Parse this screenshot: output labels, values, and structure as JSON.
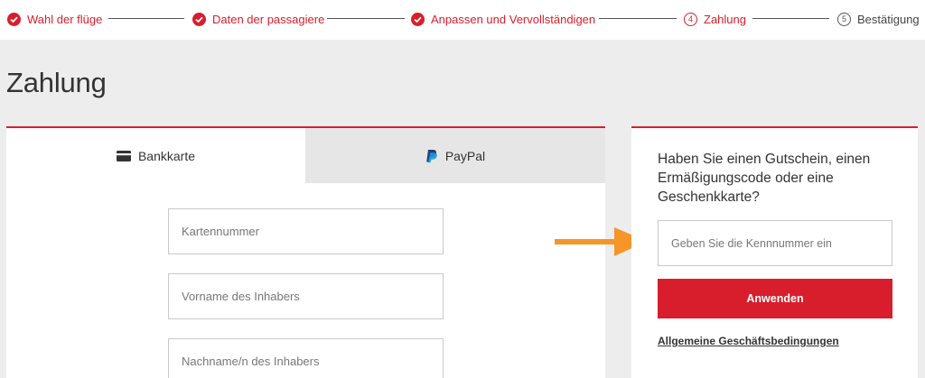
{
  "stepper": {
    "steps": [
      {
        "label": "Wahl der flüge",
        "state": "done"
      },
      {
        "label": "Daten der passagiere",
        "state": "done"
      },
      {
        "label": "Anpassen und Vervollständigen",
        "state": "done"
      },
      {
        "label": "Zahlung",
        "state": "current",
        "number": "4"
      },
      {
        "label": "Bestätigung",
        "state": "pending",
        "number": "5"
      }
    ]
  },
  "page": {
    "title": "Zahlung"
  },
  "payment": {
    "tabs": [
      {
        "label": "Bankkarte",
        "icon": "card-icon",
        "active": true
      },
      {
        "label": "PayPal",
        "icon": "paypal-icon",
        "active": false
      }
    ],
    "fields": {
      "card_number_placeholder": "Kartennummer",
      "first_name_placeholder": "Vorname des Inhabers",
      "last_name_placeholder": "Nachname/n des Inhabers"
    }
  },
  "voucher": {
    "question": "Haben Sie einen Gutschein, einen Ermäßigungscode oder eine Geschenkkarte?",
    "input_placeholder": "Geben Sie die Kennnummer ein",
    "apply_label": "Anwenden",
    "terms_link": "Allgemeine Geschäftsbedingungen"
  },
  "colors": {
    "accent": "#d81e2c",
    "annotation_arrow": "#f5952a",
    "paypal_dark": "#253b80",
    "paypal_light": "#179bd7"
  }
}
